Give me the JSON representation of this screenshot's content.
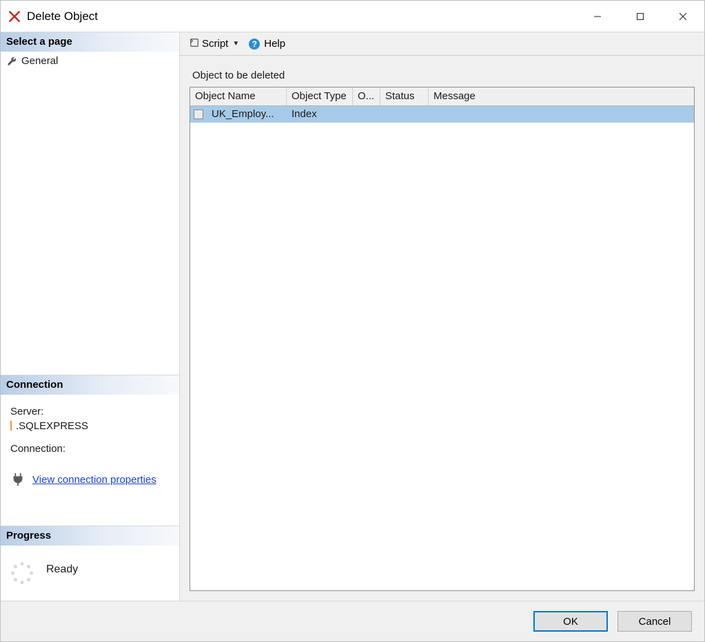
{
  "window": {
    "title": "Delete Object"
  },
  "sidebar": {
    "select_page_header": "Select a page",
    "pages": [
      {
        "label": "General"
      }
    ],
    "connection_header": "Connection",
    "connection": {
      "server_label": "Server:",
      "server_value": ".SQLEXPRESS",
      "connection_label": "Connection:",
      "view_props_link": "View connection properties"
    },
    "progress_header": "Progress",
    "progress": {
      "status_text": "Ready"
    }
  },
  "toolbar": {
    "script_label": "Script",
    "help_label": "Help"
  },
  "main": {
    "section_title": "Object to be deleted",
    "columns": {
      "name": "Object Name",
      "type": "Object Type",
      "owner": "O...",
      "status": "Status",
      "message": "Message"
    },
    "rows": [
      {
        "name": "UK_Employ...",
        "type": "Index",
        "owner": "",
        "status": "",
        "message": ""
      }
    ]
  },
  "footer": {
    "ok_label": "OK",
    "cancel_label": "Cancel"
  }
}
